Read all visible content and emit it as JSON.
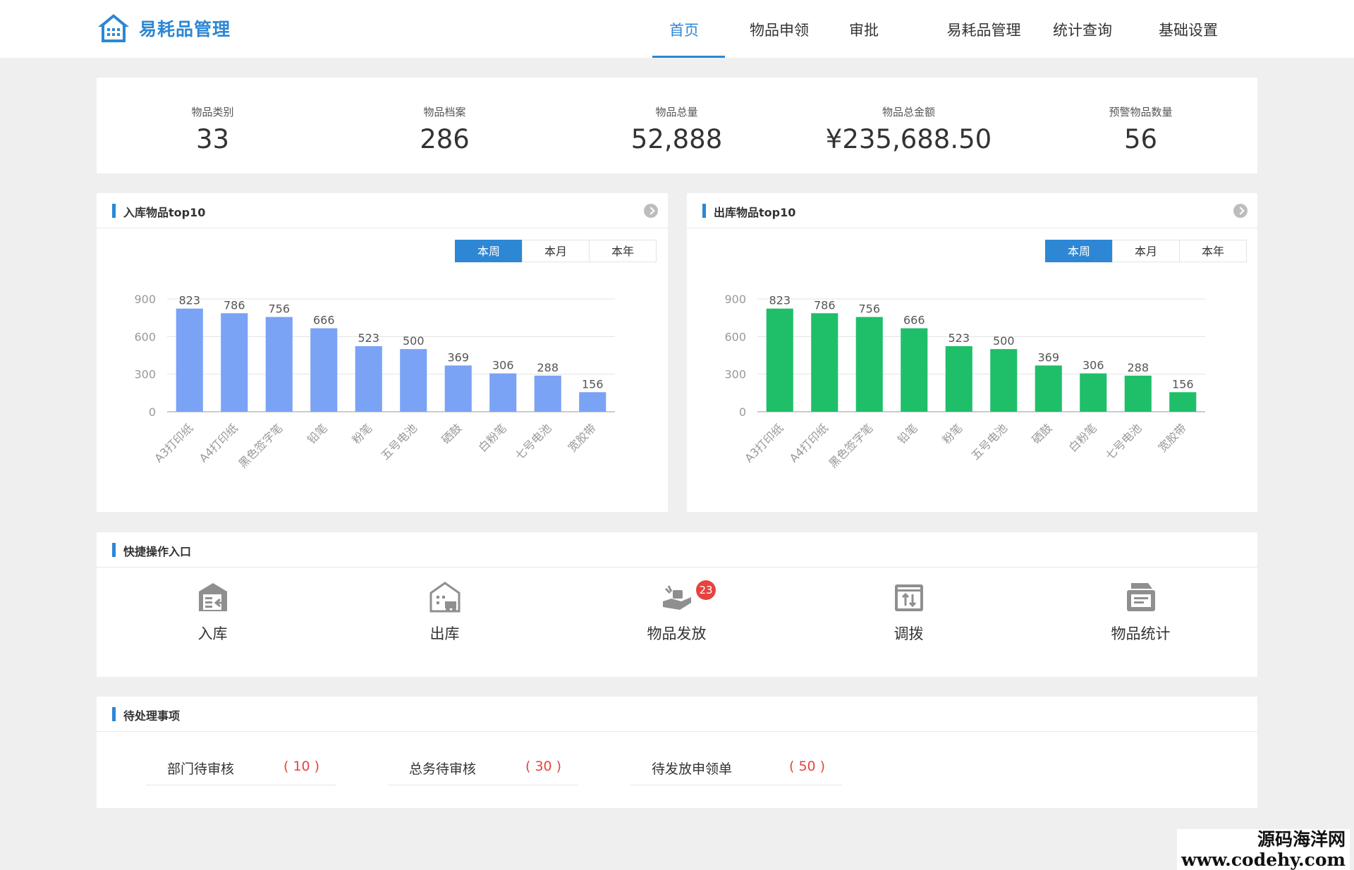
{
  "app": {
    "title": "易耗品管理"
  },
  "nav": {
    "items": [
      "首页",
      "物品申领",
      "审批",
      "易耗品管理",
      "统计查询",
      "基础设置"
    ],
    "active_index": 0
  },
  "stats": [
    {
      "label": "物品类别",
      "value": "33"
    },
    {
      "label": "物品档案",
      "value": "286"
    },
    {
      "label": "物品总量",
      "value": "52,888"
    },
    {
      "label": "物品总金额",
      "value": "¥235,688.50"
    },
    {
      "label": "预警物品数量",
      "value": "56"
    }
  ],
  "period_tabs": [
    "本周",
    "本月",
    "本年"
  ],
  "inbound_panel": {
    "title": "入库物品top10",
    "active_tab": 0
  },
  "outbound_panel": {
    "title": "出库物品top10",
    "active_tab": 0
  },
  "chart_data": [
    {
      "type": "bar",
      "title": "入库物品top10",
      "categories": [
        "A3打印纸",
        "A4打印纸",
        "黑色签字笔",
        "铅笔",
        "粉笔",
        "五号电池",
        "硒鼓",
        "白粉笔",
        "七号电池",
        "宽胶带"
      ],
      "values": [
        823,
        786,
        756,
        666,
        523,
        500,
        369,
        306,
        288,
        156
      ],
      "ylim": [
        0,
        900
      ],
      "yticks": [
        0,
        300,
        600,
        900
      ],
      "color": "#7aa2f5",
      "grid": true
    },
    {
      "type": "bar",
      "title": "出库物品top10",
      "categories": [
        "A3打印纸",
        "A4打印纸",
        "黑色签字笔",
        "铅笔",
        "粉笔",
        "五号电池",
        "硒鼓",
        "白粉笔",
        "七号电池",
        "宽胶带"
      ],
      "values": [
        823,
        786,
        756,
        666,
        523,
        500,
        369,
        306,
        288,
        156
      ],
      "ylim": [
        0,
        900
      ],
      "yticks": [
        0,
        300,
        600,
        900
      ],
      "color": "#1fbf6a",
      "grid": true
    }
  ],
  "quick_entry": {
    "title": "快捷操作入口",
    "items": [
      {
        "label": "入库",
        "icon": "warehouse-in-icon"
      },
      {
        "label": "出库",
        "icon": "warehouse-out-icon"
      },
      {
        "label": "物品发放",
        "icon": "hand-delivery-icon",
        "badge": "23"
      },
      {
        "label": "调拨",
        "icon": "transfer-icon"
      },
      {
        "label": "物品统计",
        "icon": "statistics-box-icon"
      }
    ]
  },
  "pending": {
    "title": "待处理事项",
    "items": [
      {
        "label": "部门待审核",
        "count": "( 10 )"
      },
      {
        "label": "总务待审核",
        "count": "( 30 )"
      },
      {
        "label": "待发放申领单",
        "count": "( 50 )"
      }
    ]
  },
  "watermark": {
    "line1": "源码海洋网",
    "line2": "www.codehy.com"
  },
  "colors": {
    "accent": "#2d87d4",
    "alert": "#e64340",
    "inbound_bar": "#7aa2f5",
    "outbound_bar": "#1fbf6a"
  }
}
